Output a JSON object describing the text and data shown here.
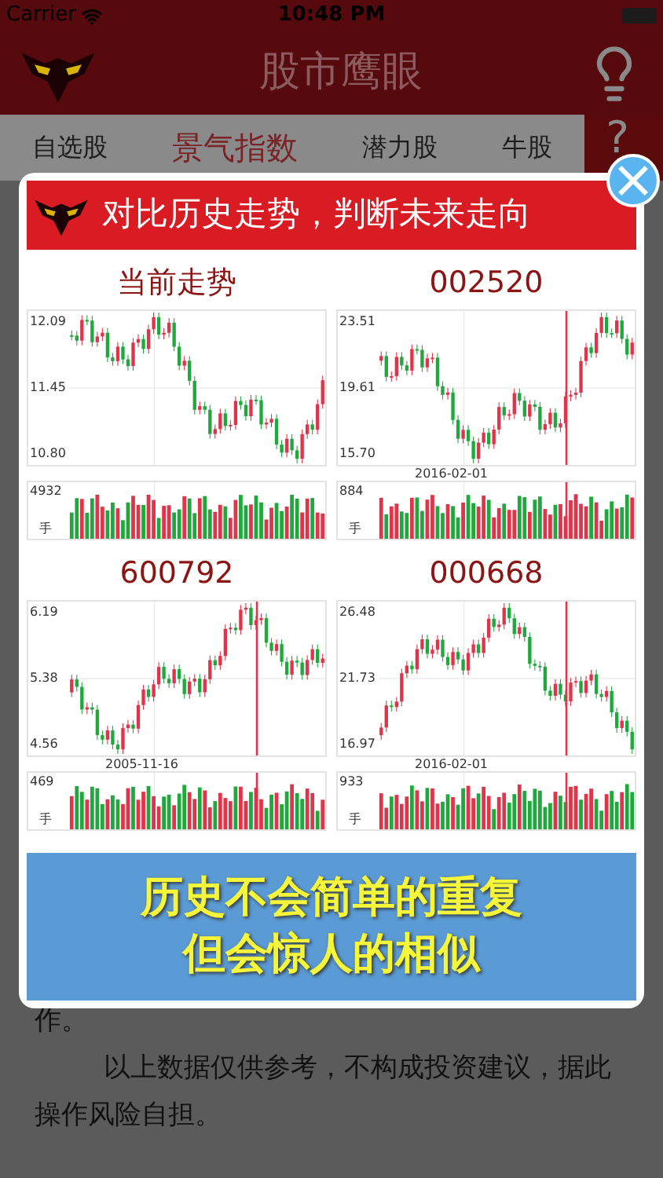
{
  "status_bar": {
    "carrier": "Carrier",
    "time": "10:48 PM"
  },
  "header": {
    "title": "股市鹰眼"
  },
  "tabs": [
    {
      "label": "自选股",
      "selected": false
    },
    {
      "label": "景气指数",
      "selected": true
    },
    {
      "label": "潜力股",
      "selected": false
    },
    {
      "label": "牛股",
      "selected": false
    }
  ],
  "help_button": {
    "label": "?"
  },
  "modal": {
    "banner": "对比历史走势，判断未来走向",
    "charts": [
      {
        "title": "当前走势",
        "y_labels": [
          "12.09",
          "11.45",
          "10.80"
        ],
        "volume_max": "4932",
        "volume_unit": "手",
        "marker": false
      },
      {
        "title": "002520",
        "y_labels": [
          "23.51",
          "19.61",
          "15.70"
        ],
        "date": "2016-02-01",
        "volume_max": "884",
        "volume_unit": "手",
        "marker": true
      },
      {
        "title": "600792",
        "y_labels": [
          "6.19",
          "5.38",
          "4.56"
        ],
        "date": "2005-11-16",
        "volume_max": "469",
        "volume_unit": "手",
        "marker": true
      },
      {
        "title": "000668",
        "y_labels": [
          "26.48",
          "21.73",
          "16.97"
        ],
        "date": "2016-02-01",
        "volume_max": "933",
        "volume_unit": "手",
        "marker": true
      }
    ],
    "slogan": [
      "历史不会简单的重复",
      "但会惊人的相似"
    ]
  },
  "body": {
    "fragment": "作。",
    "disclaimer": "以上数据仅供参考，不构成投资建议，据此操作风险自担。"
  }
}
